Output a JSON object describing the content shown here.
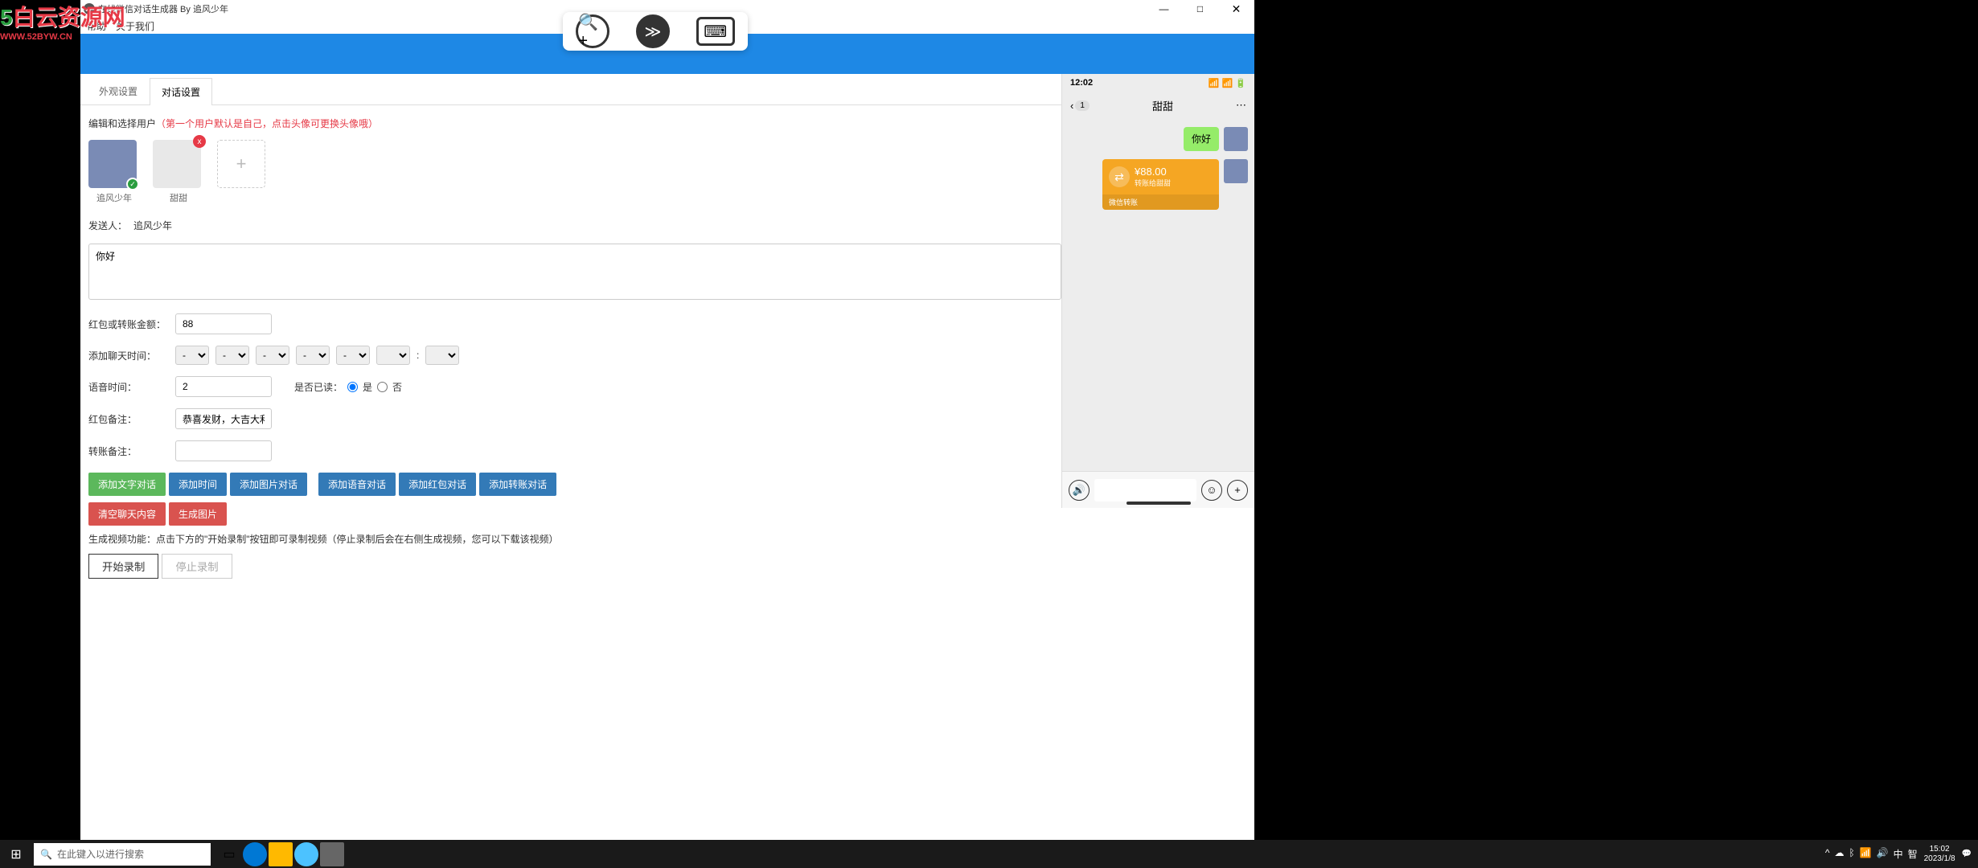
{
  "title_bar": {
    "title": "在线微信对话生成器 By 追风少年"
  },
  "menu": {
    "help": "帮助",
    "about": "关于我们"
  },
  "tabs": {
    "appearance": "外观设置",
    "dialog": "对话设置"
  },
  "editor": {
    "hint_prefix": "编辑和选择用户",
    "hint_red": "（第一个用户默认是自己，点击头像可更换头像哦）",
    "users": [
      {
        "name": "追风少年"
      },
      {
        "name": "甜甜"
      }
    ],
    "sender_label": "发送人：",
    "sender_value": "追风少年",
    "message_value": "你好",
    "amount_label": "红包或转账金额：",
    "amount_value": "88",
    "time_label": "添加聊天时间：",
    "time_placeholder": "-",
    "voice_label": "语音时间：",
    "voice_value": "2",
    "read_label": "是否已读：",
    "read_yes": "是",
    "read_no": "否",
    "redpacket_note_label": "红包备注：",
    "redpacket_note_value": "恭喜发财，大吉大利",
    "transfer_note_label": "转账备注：",
    "transfer_note_value": ""
  },
  "buttons": {
    "add_text": "添加文字对话",
    "add_time": "添加时间",
    "add_image": "添加图片对话",
    "add_voice": "添加语音对话",
    "add_redpacket": "添加红包对话",
    "add_transfer": "添加转账对话",
    "clear": "清空聊天内容",
    "gen_image": "生成图片",
    "record_note": "生成视频功能：点击下方的\"开始录制\"按钮即可录制视频（停止录制后会在右侧生成视频，您可以下载该视频）",
    "start_record": "开始录制",
    "stop_record": "停止录制"
  },
  "preview": {
    "time": "12:02",
    "unread": "1",
    "contact": "甜甜",
    "msg1": "你好",
    "transfer_amount": "¥88.00",
    "transfer_sub": "转账给甜甜",
    "transfer_label": "微信转账"
  },
  "taskbar": {
    "search_placeholder": "在此键入以进行搜索",
    "time": "15:02",
    "date": "2023/1/8"
  },
  "watermark": {
    "text1": "白",
    "text2": "云资源网",
    "url": "WWW.52BYW.CN"
  }
}
